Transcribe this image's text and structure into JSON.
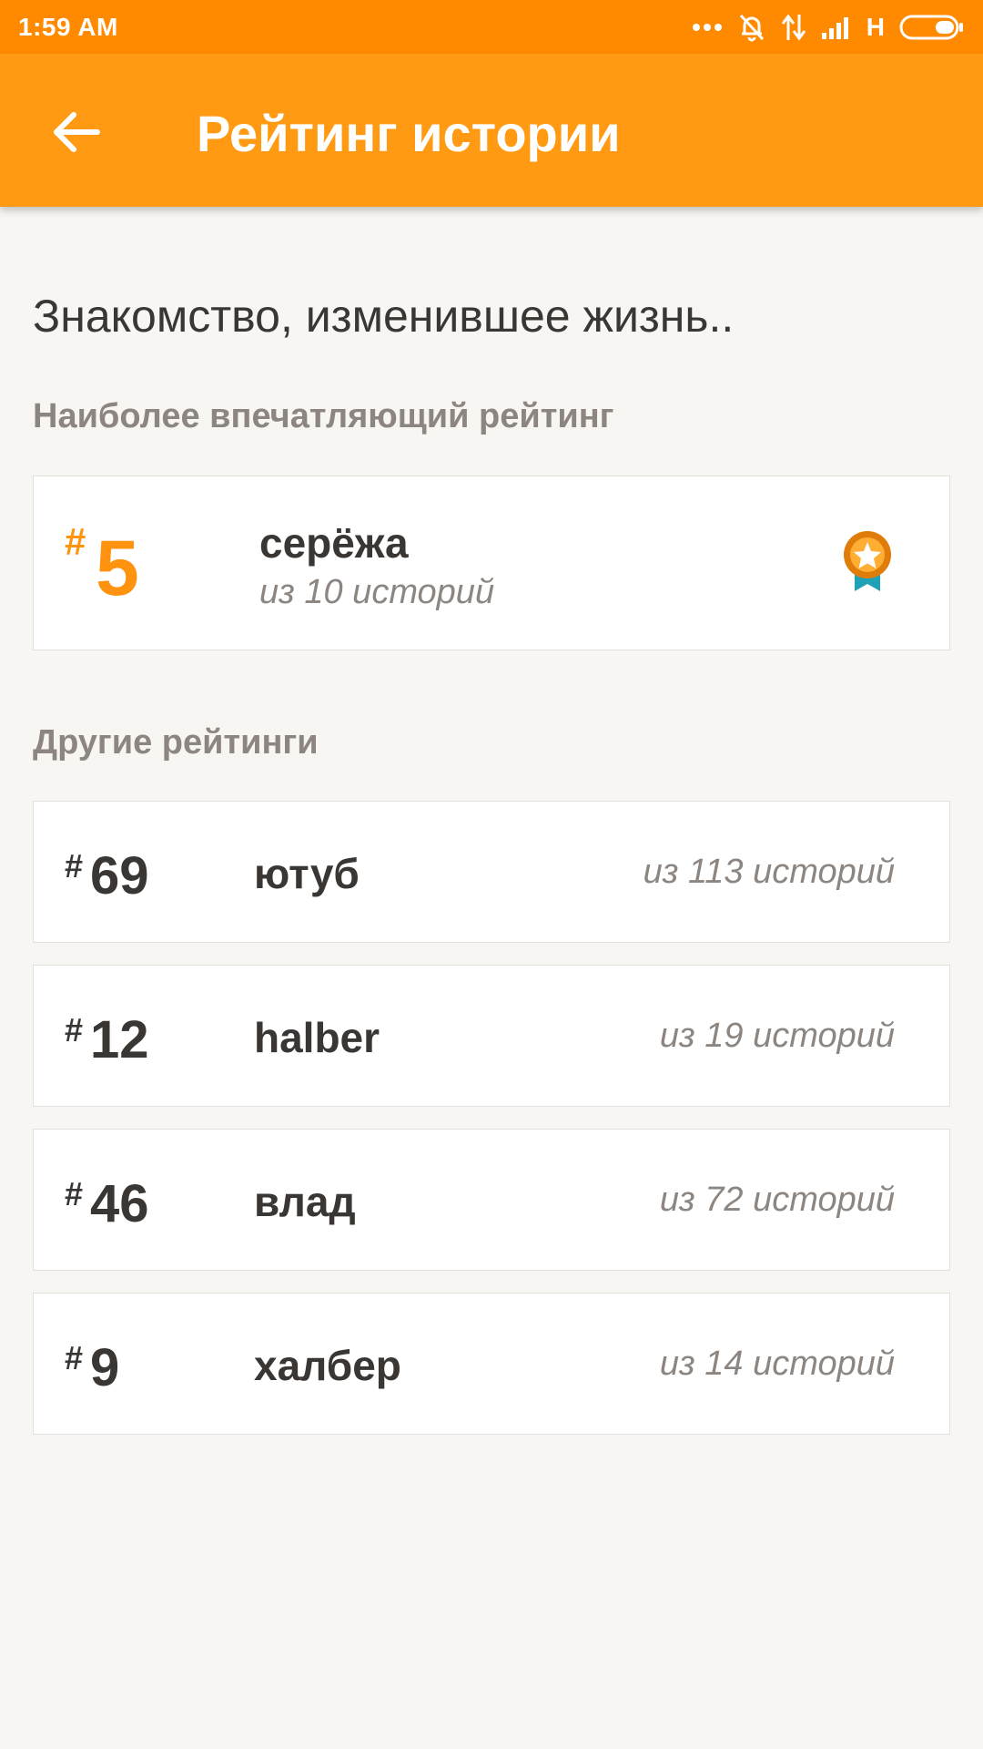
{
  "status_bar": {
    "time": "1:59 AM",
    "network": "H",
    "icons": [
      "dots-icon",
      "alarm-off-icon",
      "data-transfer-icon",
      "signal-icon",
      "battery-icon"
    ]
  },
  "app_bar": {
    "title": "Рейтинг истории",
    "back_icon": "arrow-left-icon"
  },
  "story": {
    "title": "Знакомство, изменившее жизнь.."
  },
  "top_rating": {
    "section_label": "Наиболее впечатляющий рейтинг",
    "hash": "#",
    "rank": "5",
    "name": "серёжа",
    "count": "из 10 историй",
    "badge_icon": "medal-star-icon"
  },
  "other_ratings": {
    "section_label": "Другие рейтинги",
    "items": [
      {
        "hash": "#",
        "rank": "69",
        "name": "ютуб",
        "count": "из 113 историй"
      },
      {
        "hash": "#",
        "rank": "12",
        "name": "halber",
        "count": "из 19 историй"
      },
      {
        "hash": "#",
        "rank": "46",
        "name": "влад",
        "count": "из 72 историй"
      },
      {
        "hash": "#",
        "rank": "9",
        "name": "халбер",
        "count": "из 14 историй"
      }
    ]
  },
  "colors": {
    "status_bar": "#ff8a00",
    "app_bar": "#ff9a12",
    "accent": "#ff9310",
    "ribbon": "#1fa2b8"
  }
}
